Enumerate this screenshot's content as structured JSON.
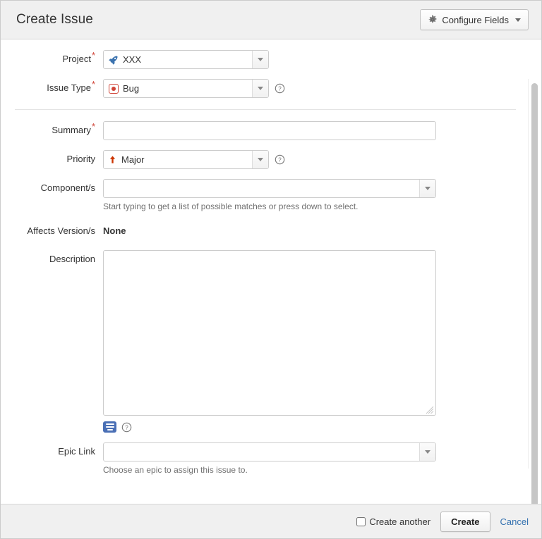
{
  "header": {
    "title": "Create Issue",
    "configure_fields_label": "Configure Fields",
    "gear_icon": "gear-icon",
    "caret_icon": "chevron-down-icon"
  },
  "fields": {
    "project": {
      "label": "Project",
      "required": true,
      "value": "XXX",
      "icon": "project-avatar-icon"
    },
    "issue_type": {
      "label": "Issue Type",
      "required": true,
      "value": "Bug",
      "icon": "bug-icon",
      "help_icon": "help-circle-icon"
    },
    "summary": {
      "label": "Summary",
      "required": true,
      "value": "",
      "placeholder": ""
    },
    "priority": {
      "label": "Priority",
      "required": false,
      "value": "Major",
      "icon": "priority-major-up-arrow-icon",
      "help_icon": "help-circle-icon"
    },
    "components": {
      "label": "Component/s",
      "required": false,
      "value": "",
      "placeholder": "",
      "hint": "Start typing to get a list of possible matches or press down to select."
    },
    "affects_versions": {
      "label": "Affects Version/s",
      "value": "None"
    },
    "description": {
      "label": "Description",
      "value": "",
      "placeholder": "",
      "wiki_button_icon": "wiki-markup-icon",
      "help_icon": "help-circle-icon"
    },
    "epic_link": {
      "label": "Epic Link",
      "required": false,
      "value": "",
      "placeholder": "",
      "hint": "Choose an epic to assign this issue to."
    }
  },
  "footer": {
    "create_another_label": "Create another",
    "create_another_checked": false,
    "create_label": "Create",
    "cancel_label": "Cancel"
  },
  "colors": {
    "required_star": "#d04437",
    "link": "#3572b0",
    "bug_red": "#d04437",
    "wiki_blue": "#4a6fb5",
    "header_bg": "#f0f0f0"
  }
}
